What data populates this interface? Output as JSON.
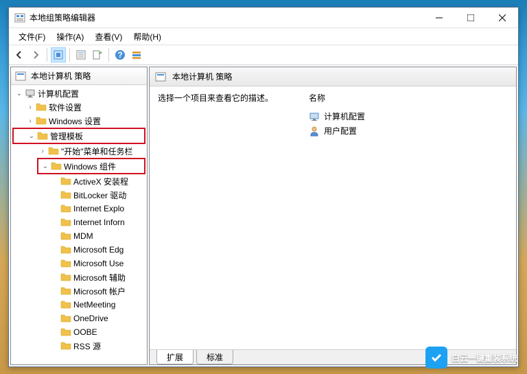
{
  "window": {
    "title": "本地组策略编辑器"
  },
  "menu": {
    "file": "文件(F)",
    "action": "操作(A)",
    "view": "查看(V)",
    "help": "帮助(H)"
  },
  "tree": {
    "root": "本地计算机 策略",
    "computer_config": "计算机配置",
    "software_settings": "软件设置",
    "windows_settings": "Windows 设置",
    "admin_templates": "管理模板",
    "start_menu": "\"开始\"菜单和任务栏",
    "windows_components": "Windows 组件",
    "items": [
      "ActiveX 安装程",
      "BitLocker 驱动",
      "Internet Explo",
      "Internet Inforn",
      "MDM",
      "Microsoft Edg",
      "Microsoft Use",
      "Microsoft 辅助",
      "Microsoft 帐户",
      "NetMeeting",
      "OneDrive",
      "OOBE",
      "RSS 源"
    ]
  },
  "right": {
    "header": "本地计算机 策略",
    "description_prompt": "选择一个项目来查看它的描述。",
    "name_header": "名称",
    "items": [
      "计算机配置",
      "用户配置"
    ]
  },
  "tabs": {
    "extended": "扩展",
    "standard": "标准"
  },
  "watermark": "白云一键重装系统"
}
